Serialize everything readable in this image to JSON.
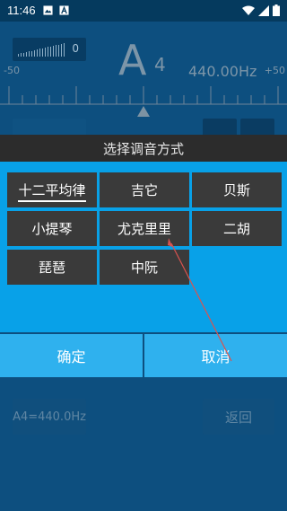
{
  "status_bar": {
    "time": "11:46",
    "left_icons": [
      "image-icon",
      "a-letter-icon"
    ],
    "right_icons": [
      "wifi-icon",
      "signal-icon",
      "battery-icon"
    ]
  },
  "tuner": {
    "level_value": "0",
    "note": "A",
    "octave": "4",
    "frequency": "440.00Hz",
    "scale_min": "-50",
    "scale_max": "+50",
    "reference_label": "A4=440.0Hz",
    "back_label": "返回"
  },
  "dialog": {
    "title": "选择调音方式",
    "options": [
      {
        "label": "十二平均律",
        "selected": true
      },
      {
        "label": "吉它",
        "selected": false
      },
      {
        "label": "贝斯",
        "selected": false
      },
      {
        "label": "小提琴",
        "selected": false
      },
      {
        "label": "尤克里里",
        "selected": false
      },
      {
        "label": "二胡",
        "selected": false
      },
      {
        "label": "琵琶",
        "selected": false
      },
      {
        "label": "中阮",
        "selected": false
      }
    ],
    "confirm_label": "确定",
    "cancel_label": "取消"
  },
  "colors": {
    "background": "#0d4f7f",
    "dialog_body": "#08a1e8",
    "option_bg": "#3a3a3a",
    "action_bg": "#2fb1ee",
    "annotation_arrow": "#d9534f"
  }
}
